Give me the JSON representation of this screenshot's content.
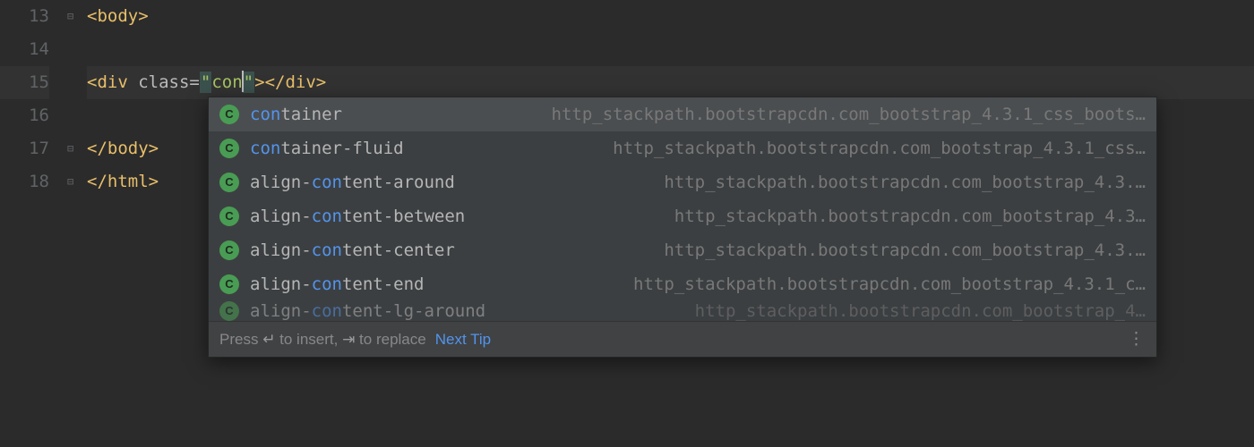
{
  "gutter": {
    "start": 13,
    "lines": [
      "13",
      "14",
      "15",
      "16",
      "17",
      "18"
    ]
  },
  "code": {
    "l13_open": "<",
    "l13_tag": "body",
    "l13_close": ">",
    "l15_open": "<",
    "l15_tag": "div ",
    "l15_attr": "class",
    "l15_eq": "=",
    "l15_q1": "\"",
    "l15_val": "con",
    "l15_q2": "\"",
    "l15_close": ">",
    "l15_endopen": "</",
    "l15_endtag": "div",
    "l15_endclose": ">",
    "l17_open": "</",
    "l17_tag": "body",
    "l17_close": ">",
    "l18_open": "</",
    "l18_tag": "html",
    "l18_close": ">"
  },
  "popup": {
    "icon_letter": "C",
    "items": [
      {
        "pre": "",
        "match": "con",
        "post": "tainer",
        "right": "http_stackpath.bootstrapcdn.com_bootstrap_4.3.1_css_boots…",
        "selected": true
      },
      {
        "pre": "",
        "match": "con",
        "post": "tainer-fluid",
        "right": "http_stackpath.bootstrapcdn.com_bootstrap_4.3.1_css…",
        "selected": false
      },
      {
        "pre": "align-",
        "match": "con",
        "post": "tent-around",
        "right": "http_stackpath.bootstrapcdn.com_bootstrap_4.3.…",
        "selected": false
      },
      {
        "pre": "align-",
        "match": "con",
        "post": "tent-between",
        "right": "http_stackpath.bootstrapcdn.com_bootstrap_4.3…",
        "selected": false
      },
      {
        "pre": "align-",
        "match": "con",
        "post": "tent-center",
        "right": "http_stackpath.bootstrapcdn.com_bootstrap_4.3.…",
        "selected": false
      },
      {
        "pre": "align-",
        "match": "con",
        "post": "tent-end",
        "right": "http_stackpath.bootstrapcdn.com_bootstrap_4.3.1_c…",
        "selected": false
      },
      {
        "pre": "align-",
        "match": "con",
        "post": "tent-lg-around",
        "right": "http_stackpath.bootstrapcdn.com_bootstrap_4…",
        "selected": false
      }
    ],
    "footer": {
      "hint_pre": "Press ",
      "key1": "↵",
      "hint_mid1": " to insert, ",
      "key2": "⇥",
      "hint_mid2": " to replace",
      "next_tip": "Next Tip",
      "more": "⋮"
    }
  }
}
